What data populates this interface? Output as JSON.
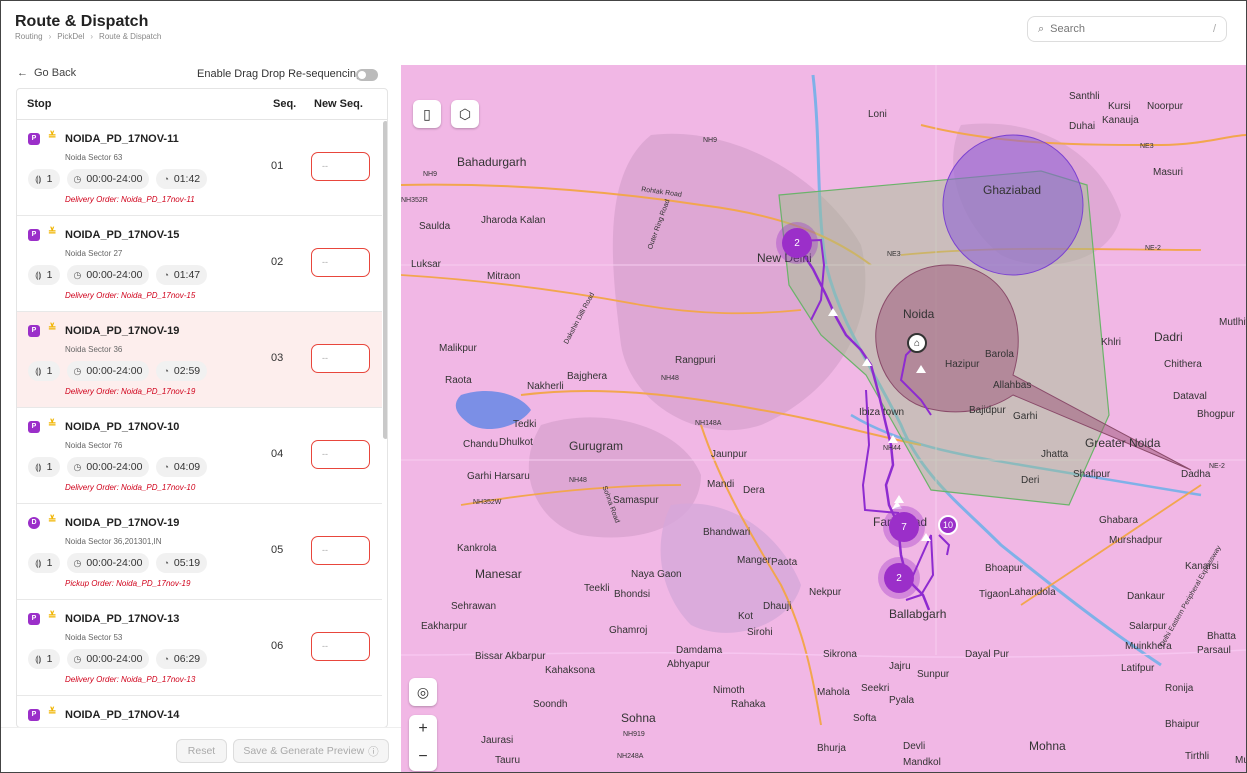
{
  "header": {
    "title": "Route & Dispatch",
    "breadcrumbs": [
      "Routing",
      "PickDel",
      "Route & Dispatch"
    ],
    "search_placeholder": "Search",
    "search_shortcut": "/"
  },
  "panel": {
    "go_back": "Go Back",
    "drag_drop_label": "Enable Drag Drop Re-sequencing",
    "drag_drop_enabled": false,
    "columns": {
      "stop": "Stop",
      "seq": "Seq.",
      "new_seq": "New Seq."
    },
    "new_seq_placeholder": "--",
    "stops": [
      {
        "badge": "P",
        "name": "NOIDA_PD_17NOV-11",
        "address": "Noida Sector 63",
        "units": "1",
        "window": "00:00-24:00",
        "eta": "01:42",
        "order": "Delivery Order: Noida_PD_17nov-11",
        "seq": "01"
      },
      {
        "badge": "P",
        "name": "NOIDA_PD_17NOV-15",
        "address": "Noida Sector 27",
        "units": "1",
        "window": "00:00-24:00",
        "eta": "01:47",
        "order": "Delivery Order: Noida_PD_17nov-15",
        "seq": "02"
      },
      {
        "badge": "P",
        "name": "NOIDA_PD_17NOV-19",
        "address": "Noida Sector 36",
        "units": "1",
        "window": "00:00-24:00",
        "eta": "02:59",
        "order": "Delivery Order: Noida_PD_17nov-19",
        "seq": "03"
      },
      {
        "badge": "P",
        "name": "NOIDA_PD_17NOV-10",
        "address": "Noida Sector 76",
        "units": "1",
        "window": "00:00-24:00",
        "eta": "04:09",
        "order": "Delivery Order: Noida_PD_17nov-10",
        "seq": "04"
      },
      {
        "badge": "D",
        "name": "NOIDA_PD_17NOV-19",
        "address": "Noida Sector 36,201301,IN",
        "units": "1",
        "window": "00:00-24:00",
        "eta": "05:19",
        "order": "Pickup Order: Noida_PD_17nov-19",
        "seq": "05"
      },
      {
        "badge": "P",
        "name": "NOIDA_PD_17NOV-13",
        "address": "Noida Sector 53",
        "units": "1",
        "window": "00:00-24:00",
        "eta": "06:29",
        "order": "Delivery Order: Noida_PD_17nov-13",
        "seq": "06"
      },
      {
        "badge": "P",
        "name": "NOIDA_PD_17NOV-14",
        "address": "",
        "units": "",
        "window": "",
        "eta": "",
        "order": "",
        "seq": ""
      }
    ],
    "reset_label": "Reset",
    "save_label": "Save & Generate Preview"
  },
  "map": {
    "clusters": [
      "2",
      "7",
      "2"
    ],
    "pin": "10",
    "zoom_in": "+",
    "zoom_out": "−",
    "places": [
      "Loni",
      "Santhli",
      "Kursi",
      "Noorpur",
      "Duhai",
      "Kanauja",
      "Bahadurgarh",
      "Ghaziabad",
      "Masuri",
      "Saulda",
      "Jharoda Kalan",
      "Luksar",
      "Mitraon",
      "New Delhi",
      "Noida",
      "Dadri",
      "Mutlhiya",
      "Chithera",
      "Khlri",
      "Hazipur",
      "Barola",
      "Malikpur",
      "Rangpuri",
      "Bajghera",
      "Nakherli",
      "Raota",
      "Dataval",
      "Bhogpur",
      "Allahbas",
      "Ibiza town",
      "Bajidpur",
      "Garhi",
      "Tedki",
      "Chandu",
      "Dhulkot",
      "Gurugram",
      "Jaunpur",
      "Greater Noida",
      "Jhatta",
      "Shafipur",
      "Dadha",
      "Deri",
      "Garhi Harsaru",
      "Mandi",
      "Dera",
      "Samaspur",
      "Faridabad",
      "Ghabara",
      "Murshadpur",
      "Bhandwari",
      "Kankrola",
      "Manger",
      "Paota",
      "Manesar",
      "Naya Gaon",
      "Bhoapur",
      "Kanarsi",
      "Teekli",
      "Bhondsi",
      "Nekpur",
      "Tigaon",
      "Lahandola",
      "Dankaur",
      "Sehrawan",
      "Dhauji",
      "Ballabgarh",
      "Salarpur",
      "Eakharpur",
      "Ghamroj",
      "Kot",
      "Sirohi",
      "Bhatta",
      "Muinkhera",
      "Parsaul",
      "Bissar Akbarpur",
      "Damdama",
      "Sikrona",
      "Dayal Pur",
      "Abhyapur",
      "Jajru",
      "Latifpur",
      "Kahaksona",
      "Sunpur",
      "Nimoth",
      "Mahola",
      "Seekri",
      "Ronija",
      "Soondh",
      "Rahaka",
      "Pyala",
      "Sohna",
      "Softa",
      "Bhaipur",
      "Jaurasi",
      "Tauru",
      "Bhurja",
      "Devli",
      "Mandkol",
      "Mohna",
      "Tirthli",
      "Mu"
    ],
    "road_labels": [
      "NH9",
      "NH9",
      "NE3",
      "NE3",
      "NH48",
      "NE-2",
      "NE-2",
      "NH352R",
      "NH148A",
      "NH48",
      "NH352W",
      "NH919",
      "NH248A",
      "NH44",
      "Rohtak Road",
      "Outer Ring Road",
      "Dakshin Dilli Road",
      "Sohna Road",
      "Delhi Eastern Peripheral Expressway"
    ],
    "colors": {
      "route": "#8e2bd0",
      "land": "#f1b7e5",
      "zone_green": "#8fbc70",
      "zone_purple": "#8a5cd6",
      "zone_maroon": "#9b5577"
    }
  }
}
